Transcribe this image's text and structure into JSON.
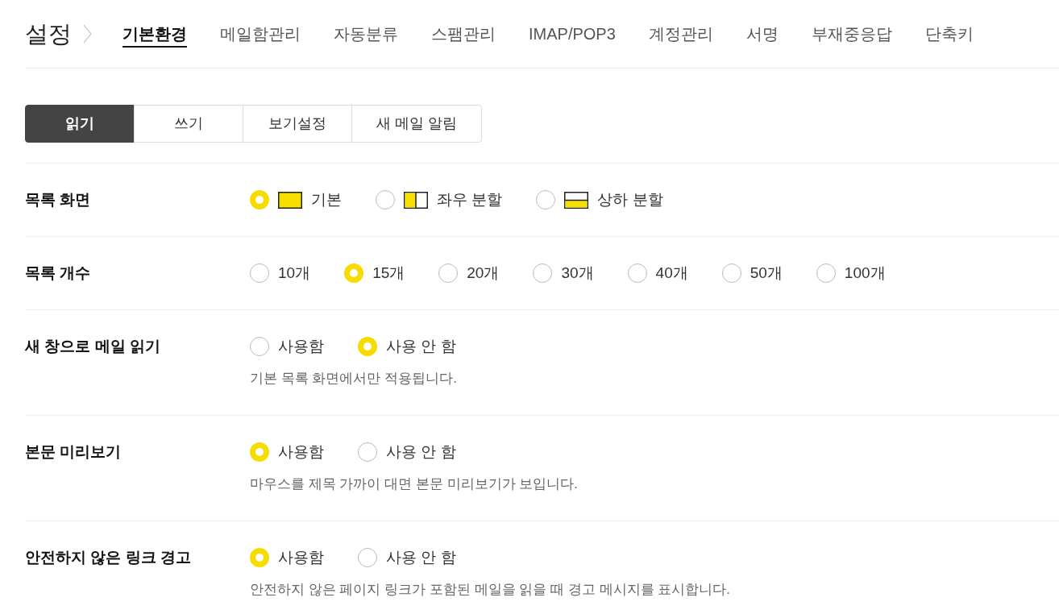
{
  "header": {
    "title": "설정",
    "nav": [
      {
        "label": "기본환경",
        "selected": true
      },
      {
        "label": "메일함관리",
        "selected": false
      },
      {
        "label": "자동분류",
        "selected": false
      },
      {
        "label": "스팸관리",
        "selected": false
      },
      {
        "label": "IMAP/POP3",
        "selected": false
      },
      {
        "label": "계정관리",
        "selected": false
      },
      {
        "label": "서명",
        "selected": false
      },
      {
        "label": "부재중응답",
        "selected": false
      },
      {
        "label": "단축키",
        "selected": false
      }
    ]
  },
  "subtabs": [
    {
      "label": "읽기",
      "selected": true
    },
    {
      "label": "쓰기",
      "selected": false
    },
    {
      "label": "보기설정",
      "selected": false
    },
    {
      "label": "새 메일 알림",
      "selected": false
    }
  ],
  "settings": [
    {
      "label": "목록 화면",
      "options": [
        {
          "label": "기본",
          "selected": true,
          "kind": "full"
        },
        {
          "label": "좌우 분할",
          "selected": false,
          "kind": "columns"
        },
        {
          "label": "상하 분할",
          "selected": false,
          "kind": "rows"
        }
      ]
    },
    {
      "label": "목록 개수",
      "options": [
        {
          "label": "10개",
          "selected": false
        },
        {
          "label": "15개",
          "selected": true
        },
        {
          "label": "20개",
          "selected": false
        },
        {
          "label": "30개",
          "selected": false
        },
        {
          "label": "40개",
          "selected": false
        },
        {
          "label": "50개",
          "selected": false
        },
        {
          "label": "100개",
          "selected": false
        }
      ]
    },
    {
      "label": "새 창으로 메일 읽기",
      "options": [
        {
          "label": "사용함",
          "selected": false
        },
        {
          "label": "사용 안 함",
          "selected": true
        }
      ],
      "help": "기본 목록 화면에서만 적용됩니다."
    },
    {
      "label": "본문 미리보기",
      "options": [
        {
          "label": "사용함",
          "selected": true
        },
        {
          "label": "사용 안 함",
          "selected": false
        }
      ],
      "help": "마우스를 제목 가까이 대면 본문 미리보기가 보입니다."
    },
    {
      "label": "안전하지 않은 링크 경고",
      "options": [
        {
          "label": "사용함",
          "selected": true
        },
        {
          "label": "사용 안 함",
          "selected": false
        }
      ],
      "help": "안전하지 않은 페이지 링크가 포함된 메일을 읽을 때 경고 메시지를 표시합니다."
    }
  ]
}
